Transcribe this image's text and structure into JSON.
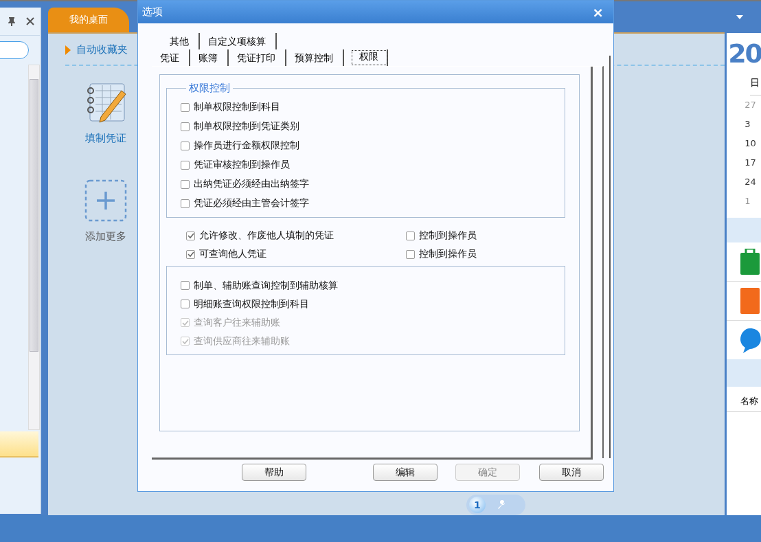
{
  "desktop": {
    "tab": {
      "label": "我的桌面",
      "selected": true
    },
    "favorites": "自动收藏夹",
    "shortcuts": [
      {
        "label": "填制凭证",
        "kind": "voucher"
      },
      {
        "label": "添加更多",
        "kind": "add"
      }
    ],
    "pager": {
      "page": "1"
    }
  },
  "calendar": {
    "year": "20",
    "weekday": "日",
    "days": [
      "27",
      "3",
      "10",
      "17",
      "24",
      "1"
    ],
    "list_header": "名称"
  },
  "dialog": {
    "title": "选项",
    "close": "×",
    "tab_rows": [
      [
        {
          "label": "其他",
          "selected": false
        },
        {
          "label": "自定义项核算",
          "selected": false
        }
      ],
      [
        {
          "label": "凭证",
          "selected": false
        },
        {
          "label": "账簿",
          "selected": false
        },
        {
          "label": "凭证打印",
          "selected": false
        },
        {
          "label": "预算控制",
          "selected": false
        },
        {
          "label": "权限",
          "selected": true
        }
      ]
    ],
    "group": {
      "title": "权限控制",
      "items": [
        {
          "label": "制单权限控制到科目",
          "checked": false
        },
        {
          "label": "制单权限控制到凭证类别",
          "checked": false
        },
        {
          "label": "操作员进行金额权限控制",
          "checked": false
        },
        {
          "label": "凭证审核控制到操作员",
          "checked": false
        },
        {
          "label": "出纳凭证必须经由出纳签字",
          "checked": false
        },
        {
          "label": "凭证必须经由主管会计签字",
          "checked": false
        }
      ]
    },
    "pairs": [
      {
        "label": "允许修改、作废他人填制的凭证",
        "checked": true,
        "sub": {
          "label": "控制到操作员",
          "checked": false
        }
      },
      {
        "label": "可查询他人凭证",
        "checked": true,
        "sub": {
          "label": "控制到操作员",
          "checked": false
        }
      }
    ],
    "lower": [
      {
        "label": "制单、辅助账查询控制到辅助核算",
        "checked": false,
        "disabled": false
      },
      {
        "label": "明细账查询权限控制到科目",
        "checked": false,
        "disabled": false
      },
      {
        "label": "查询客户往来辅助账",
        "checked": true,
        "disabled": true
      },
      {
        "label": "查询供应商往来辅助账",
        "checked": true,
        "disabled": true
      }
    ],
    "buttons": [
      {
        "label": "帮助",
        "disabled": false
      },
      {
        "label": "编辑",
        "disabled": false
      },
      {
        "label": "确定",
        "disabled": true
      },
      {
        "label": "取消",
        "disabled": false
      }
    ]
  }
}
